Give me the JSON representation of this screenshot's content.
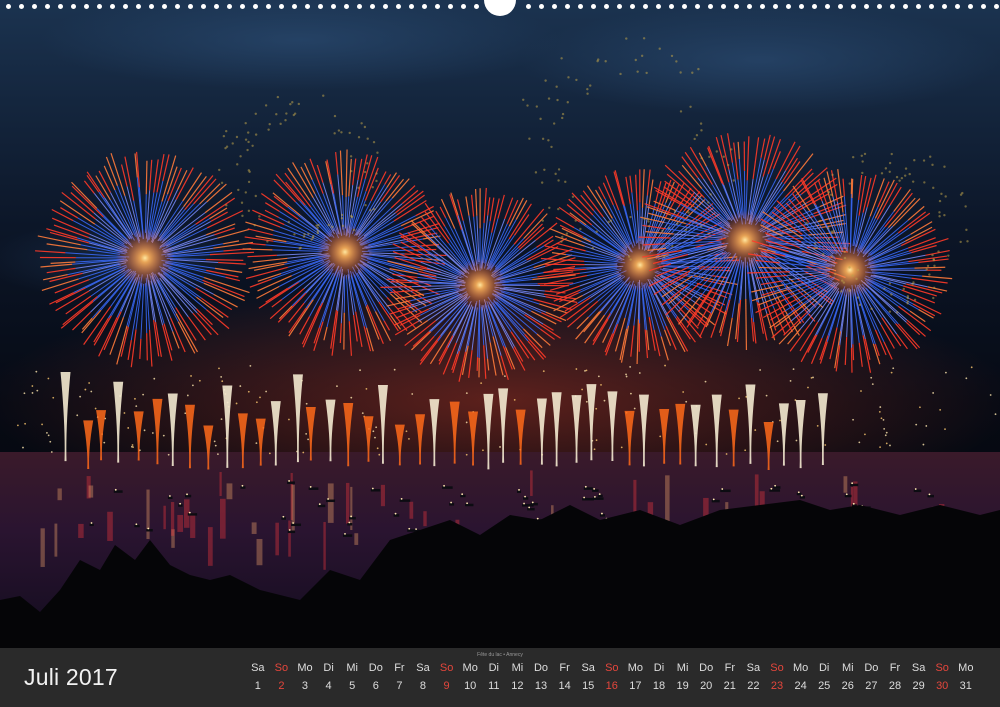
{
  "calendar": {
    "month_label": "Juli 2017",
    "photo_caption": "Fête du lac • Annecy",
    "sunday_color": "#e4463c",
    "days": [
      {
        "wd": "Sa",
        "d": "1"
      },
      {
        "wd": "So",
        "d": "2"
      },
      {
        "wd": "Mo",
        "d": "3"
      },
      {
        "wd": "Di",
        "d": "4"
      },
      {
        "wd": "Mi",
        "d": "5"
      },
      {
        "wd": "Do",
        "d": "6"
      },
      {
        "wd": "Fr",
        "d": "7"
      },
      {
        "wd": "Sa",
        "d": "8"
      },
      {
        "wd": "So",
        "d": "9"
      },
      {
        "wd": "Mo",
        "d": "10"
      },
      {
        "wd": "Di",
        "d": "11"
      },
      {
        "wd": "Mi",
        "d": "12"
      },
      {
        "wd": "Do",
        "d": "13"
      },
      {
        "wd": "Fr",
        "d": "14"
      },
      {
        "wd": "Sa",
        "d": "15"
      },
      {
        "wd": "So",
        "d": "16"
      },
      {
        "wd": "Mo",
        "d": "17"
      },
      {
        "wd": "Di",
        "d": "18"
      },
      {
        "wd": "Mi",
        "d": "19"
      },
      {
        "wd": "Do",
        "d": "20"
      },
      {
        "wd": "Fr",
        "d": "21"
      },
      {
        "wd": "Sa",
        "d": "22"
      },
      {
        "wd": "So",
        "d": "23"
      },
      {
        "wd": "Mo",
        "d": "24"
      },
      {
        "wd": "Di",
        "d": "25"
      },
      {
        "wd": "Mi",
        "d": "26"
      },
      {
        "wd": "Do",
        "d": "27"
      },
      {
        "wd": "Fr",
        "d": "28"
      },
      {
        "wd": "Sa",
        "d": "29"
      },
      {
        "wd": "So",
        "d": "30"
      },
      {
        "wd": "Mo",
        "d": "31"
      }
    ]
  }
}
